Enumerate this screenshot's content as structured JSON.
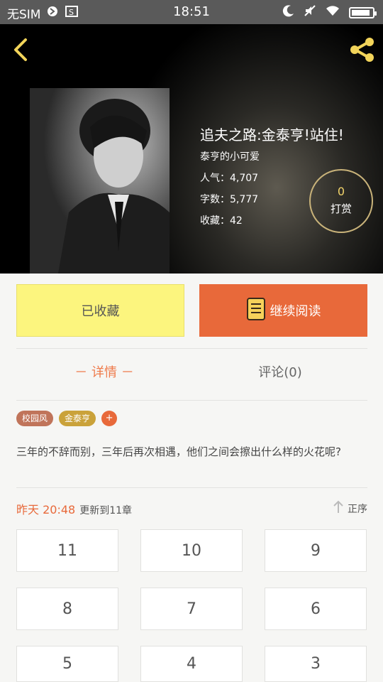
{
  "status_bar": {
    "carrier": "无SIM",
    "time": "18:51",
    "battery_level": 0.9
  },
  "book": {
    "title": "追夫之路:金泰亨!站住!",
    "author": "泰亨的小可爱",
    "popularity": "人气：4,707",
    "word_count": "字数：5,777",
    "favorites": "收藏：42",
    "reward_count": "0",
    "reward_label": "打赏"
  },
  "actions": {
    "favorite_label": "已收藏",
    "continue_label": "继续阅读"
  },
  "tabs": {
    "detail": "－ 详情 －",
    "comments": "评论(0)"
  },
  "tags": [
    {
      "label": "校园风",
      "color": "#c0745a"
    },
    {
      "label": "金泰亨",
      "color": "#caa23a"
    }
  ],
  "tag_add": "+",
  "description": "三年的不辞而别，三年后再次相遇，他们之间会擦出什么样的火花呢?",
  "update": {
    "when": "昨天 20:48",
    "what": "更新到11章"
  },
  "sort_label": "正序",
  "chapters": [
    "11",
    "10",
    "9",
    "8",
    "7",
    "6",
    "5",
    "4",
    "3"
  ],
  "colors": {
    "accent": "#e8693a",
    "favorite_bg": "#fcf57e",
    "reward_ring": "#c9b37a"
  }
}
